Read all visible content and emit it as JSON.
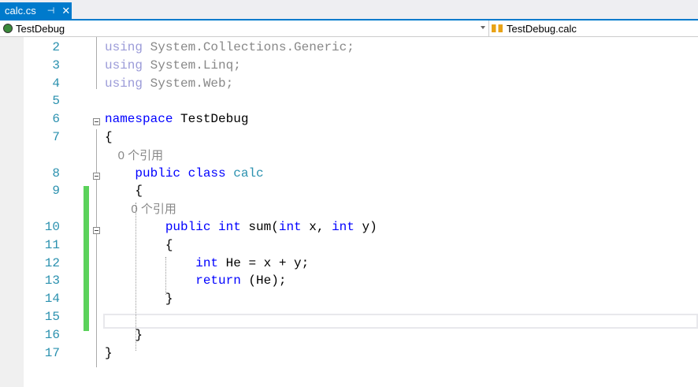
{
  "tab": {
    "title": "calc.cs",
    "pin": "⊣",
    "close": "✕"
  },
  "nav": {
    "project": "TestDebug",
    "member": "TestDebug.calc"
  },
  "lines": [
    {
      "n": "2",
      "parts": [
        [
          "dim",
          "using"
        ],
        [
          "dimt",
          " System.Collections.Generic;"
        ]
      ]
    },
    {
      "n": "3",
      "parts": [
        [
          "dim",
          "using"
        ],
        [
          "dimt",
          " System.Linq;"
        ]
      ]
    },
    {
      "n": "4",
      "parts": [
        [
          "dim",
          "using"
        ],
        [
          "dimt",
          " System.Web;"
        ]
      ]
    },
    {
      "n": "5",
      "parts": []
    },
    {
      "n": "6",
      "parts": [
        [
          "kw",
          "namespace"
        ],
        [
          "",
          " TestDebug"
        ]
      ]
    },
    {
      "n": "7",
      "parts": [
        [
          "",
          "{"
        ]
      ]
    },
    {
      "lens": "    0 个引用"
    },
    {
      "n": "8",
      "parts": [
        [
          "",
          "    "
        ],
        [
          "kw",
          "public class"
        ],
        [
          "",
          " "
        ],
        [
          "ty",
          "calc"
        ]
      ]
    },
    {
      "n": "9",
      "parts": [
        [
          "",
          "    {"
        ]
      ]
    },
    {
      "lens": "        0 个引用"
    },
    {
      "n": "10",
      "parts": [
        [
          "",
          "        "
        ],
        [
          "kw",
          "public int"
        ],
        [
          "",
          " sum("
        ],
        [
          "kw",
          "int"
        ],
        [
          "",
          " x, "
        ],
        [
          "kw",
          "int"
        ],
        [
          "",
          " y)"
        ]
      ]
    },
    {
      "n": "11",
      "parts": [
        [
          "",
          "        {"
        ]
      ]
    },
    {
      "n": "12",
      "parts": [
        [
          "",
          "            "
        ],
        [
          "kw",
          "int"
        ],
        [
          "",
          " He = x + y;"
        ]
      ]
    },
    {
      "n": "13",
      "parts": [
        [
          "",
          "            "
        ],
        [
          "kw",
          "return"
        ],
        [
          "",
          " (He);"
        ]
      ]
    },
    {
      "n": "14",
      "parts": [
        [
          "",
          "        }"
        ]
      ]
    },
    {
      "n": "15",
      "parts": []
    },
    {
      "n": "16",
      "parts": [
        [
          "",
          "    }"
        ]
      ]
    },
    {
      "n": "17",
      "parts": [
        [
          "",
          "}"
        ]
      ]
    }
  ]
}
